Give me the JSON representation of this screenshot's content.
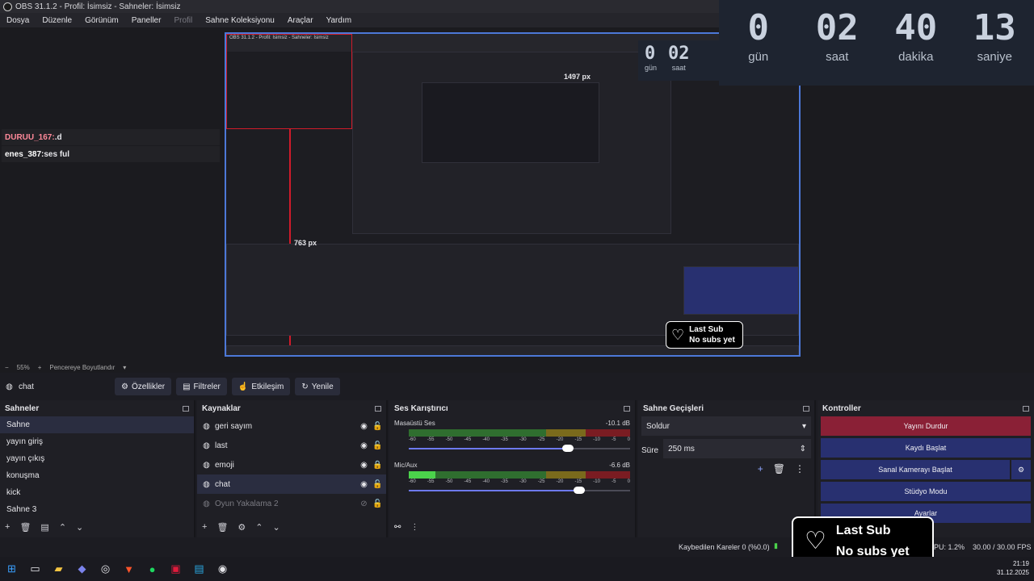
{
  "window": {
    "title": "OBS 31.1.2 - Profil: İsimsiz - Sahneler: İsimsiz"
  },
  "menu": [
    "Dosya",
    "Düzenle",
    "Görünüm",
    "Paneller",
    "Profil",
    "Sahne Koleksiyonu",
    "Araçlar",
    "Yardım"
  ],
  "countdown": {
    "cells": [
      {
        "value": "0",
        "label": "gün"
      },
      {
        "value": "02",
        "label": "saat"
      },
      {
        "value": "40",
        "label": "dakika"
      },
      {
        "value": "13",
        "label": "saniye"
      }
    ]
  },
  "chat": [
    {
      "user": "DURUU_167:",
      "text": " .d"
    },
    {
      "user": "enes_387:",
      "text": " ses ful"
    }
  ],
  "nested_preview": {
    "size_label_1": "1497 px",
    "size_label_2": "763 px",
    "mini_count": [
      {
        "value": "0",
        "label": "gün"
      },
      {
        "value": "02",
        "label": "saat"
      }
    ]
  },
  "zoom": {
    "percent": "55%",
    "fit_label": "Pencereye Boyutlandır"
  },
  "source_toolbar": {
    "current_source": "chat",
    "buttons": [
      "Özellikler",
      "Filtreler",
      "Etkileşim",
      "Yenile"
    ]
  },
  "scenes": {
    "title": "Sahneler",
    "items": [
      "Sahne",
      "yayın giriş",
      "yayın çıkış",
      "konuşma",
      "kick",
      "Sahne 3"
    ],
    "selected_index": 0
  },
  "sources": {
    "title": "Kaynaklar",
    "items": [
      {
        "name": "geri sayım",
        "visible": true,
        "locked": false
      },
      {
        "name": "last",
        "visible": true,
        "locked": false
      },
      {
        "name": "emoji",
        "visible": true,
        "locked": true
      },
      {
        "name": "chat",
        "visible": true,
        "locked": false
      },
      {
        "name": "Oyun Yakalama 2",
        "visible": false,
        "locked": false
      }
    ],
    "selected_index": 3
  },
  "mixer": {
    "title": "Ses Karıştırıcı",
    "ticks": [
      "-60",
      "-55",
      "-50",
      "-45",
      "-40",
      "-35",
      "-30",
      "-25",
      "-20",
      "-15",
      "-10",
      "-5",
      "0"
    ],
    "channels": [
      {
        "name": "Masaüstü Ses",
        "db": "-10.1 dB",
        "level": 0.0,
        "volume": 0.72
      },
      {
        "name": "Mic/Aux",
        "db": "-6.6 dB",
        "level": 0.12,
        "volume": 0.77
      }
    ]
  },
  "transitions": {
    "title": "Sahne Geçişleri",
    "selected": "Soldur",
    "duration_label": "Süre",
    "duration_value": "250 ms"
  },
  "controls": {
    "title": "Kontroller",
    "buttons": [
      "Yayını Durdur",
      "Kaydı Başlat",
      "Sanal Kamerayı Başlat",
      "Stüdyo Modu",
      "Ayarlar"
    ]
  },
  "status": {
    "dropped_frames": "Kaybedilen Kareler 0 (%0.0)",
    "cpu": "PU: 1.2%",
    "fps": "30.00 / 30.00 FPS"
  },
  "last_sub": {
    "title": "Last Sub",
    "text": "No subs yet"
  },
  "taskbar": {
    "time": "21:19",
    "date": "31.12.2025"
  },
  "colors": {
    "accent": "#4c78d8",
    "stop_stream": "#8a2036",
    "control_btn": "#283070"
  }
}
